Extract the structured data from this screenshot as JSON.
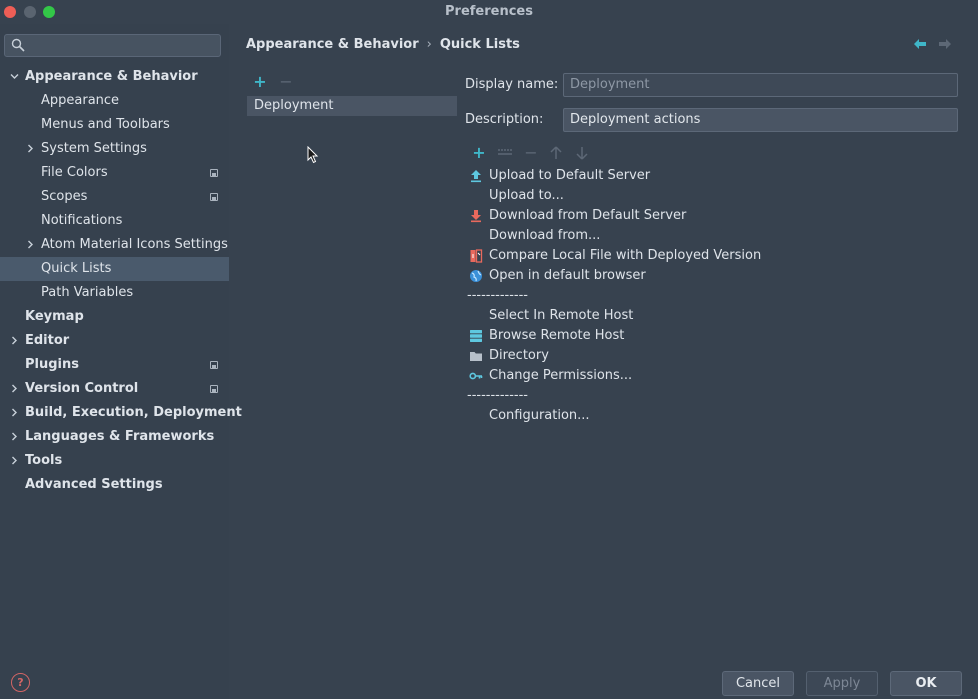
{
  "window": {
    "title": "Preferences"
  },
  "colors": {
    "accent": "#3fb6c8",
    "selection": "#4a5a6c",
    "background": "#37424f"
  },
  "search": {
    "value": "",
    "placeholder": ""
  },
  "tree": [
    {
      "label": "Appearance & Behavior",
      "level": 0,
      "bold": true,
      "arrow": "down"
    },
    {
      "label": "Appearance",
      "level": 1
    },
    {
      "label": "Menus and Toolbars",
      "level": 1
    },
    {
      "label": "System Settings",
      "level": 1,
      "arrow": "right"
    },
    {
      "label": "File Colors",
      "level": 1,
      "badge": true
    },
    {
      "label": "Scopes",
      "level": 1,
      "badge": true
    },
    {
      "label": "Notifications",
      "level": 1
    },
    {
      "label": "Atom Material Icons Settings",
      "level": 1,
      "arrow": "right"
    },
    {
      "label": "Quick Lists",
      "level": 1,
      "selected": true
    },
    {
      "label": "Path Variables",
      "level": 1
    },
    {
      "label": "Keymap",
      "level": 0,
      "bold": true
    },
    {
      "label": "Editor",
      "level": 0,
      "bold": true,
      "arrow": "right"
    },
    {
      "label": "Plugins",
      "level": 0,
      "bold": true,
      "badge": true
    },
    {
      "label": "Version Control",
      "level": 0,
      "bold": true,
      "arrow": "right",
      "badge": true
    },
    {
      "label": "Build, Execution, Deployment",
      "level": 0,
      "bold": true,
      "arrow": "right"
    },
    {
      "label": "Languages & Frameworks",
      "level": 0,
      "bold": true,
      "arrow": "right"
    },
    {
      "label": "Tools",
      "level": 0,
      "bold": true,
      "arrow": "right"
    },
    {
      "label": "Advanced Settings",
      "level": 0,
      "bold": true
    }
  ],
  "breadcrumb": {
    "parent": "Appearance & Behavior",
    "separator": "›",
    "current": "Quick Lists"
  },
  "quick_lists": {
    "items": [
      "Deployment"
    ]
  },
  "form": {
    "display_name_label": "Display name:",
    "display_name_placeholder": "Deployment",
    "description_label": "Description:",
    "description_value": "Deployment actions"
  },
  "actions": [
    {
      "label": "Upload to Default Server",
      "icon": "upload-icon"
    },
    {
      "label": "Upload to...",
      "icon": ""
    },
    {
      "label": "Download from Default Server",
      "icon": "download-icon"
    },
    {
      "label": "Download from...",
      "icon": ""
    },
    {
      "label": "Compare Local File with Deployed Version",
      "icon": "compare-icon"
    },
    {
      "label": "Open in default browser",
      "icon": "globe-icon"
    },
    {
      "label": "-------------",
      "separator": true
    },
    {
      "label": "Select In Remote Host",
      "icon": ""
    },
    {
      "label": "Browse Remote Host",
      "icon": "server-icon"
    },
    {
      "label": "Directory",
      "icon": "folder-icon"
    },
    {
      "label": "Change Permissions...",
      "icon": "key-icon"
    },
    {
      "label": "-------------",
      "separator": true
    },
    {
      "label": "Configuration...",
      "icon": ""
    }
  ],
  "buttons": {
    "cancel": "Cancel",
    "apply": "Apply",
    "ok": "OK"
  },
  "help": {
    "label": "?"
  }
}
